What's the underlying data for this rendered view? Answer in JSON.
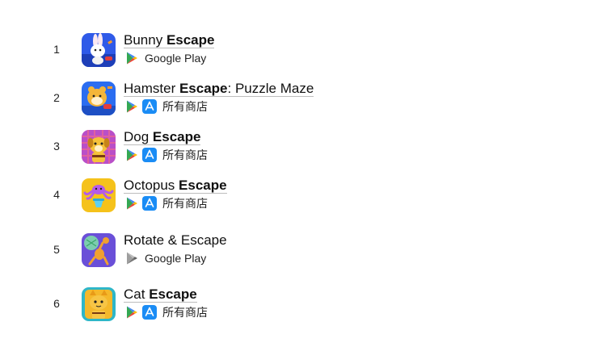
{
  "apps": [
    {
      "rank": "1",
      "title_pre": "Bunny ",
      "title_kw": "Escape",
      "title_post": "",
      "stores": [
        "google-play"
      ],
      "store_text": "Google Play",
      "icon_name": "bunny-escape-icon",
      "icon_bg": "#2f5ae8"
    },
    {
      "rank": "2",
      "title_pre": "Hamster ",
      "title_kw": "Escape",
      "title_post": ": Puzzle Maze",
      "stores": [
        "google-play",
        "app-store"
      ],
      "store_text": "所有商店",
      "icon_name": "hamster-escape-icon",
      "icon_bg": "#2b6df0"
    },
    {
      "rank": "3",
      "title_pre": "Dog ",
      "title_kw": "Escape",
      "title_post": "",
      "stores": [
        "google-play",
        "app-store"
      ],
      "store_text": "所有商店",
      "icon_name": "dog-escape-icon",
      "icon_bg": "#b94fc8"
    },
    {
      "rank": "4",
      "title_pre": "Octopus ",
      "title_kw": "Escape",
      "title_post": "",
      "stores": [
        "google-play",
        "app-store"
      ],
      "store_text": "所有商店",
      "icon_name": "octopus-escape-icon",
      "icon_bg": "#f5c21b"
    },
    {
      "rank": "5",
      "title_pre": "Rotate & Escape",
      "title_kw": "",
      "title_post": "",
      "stores": [
        "google-play-grey"
      ],
      "store_text": "Google Play",
      "icon_name": "rotate-escape-icon",
      "icon_bg": "#6a4fd8"
    },
    {
      "rank": "6",
      "title_pre": "Cat ",
      "title_kw": "Escape",
      "title_post": "",
      "stores": [
        "google-play",
        "app-store"
      ],
      "store_text": "所有商店",
      "icon_name": "cat-escape-icon",
      "icon_bg": "#2eb6c8"
    }
  ]
}
